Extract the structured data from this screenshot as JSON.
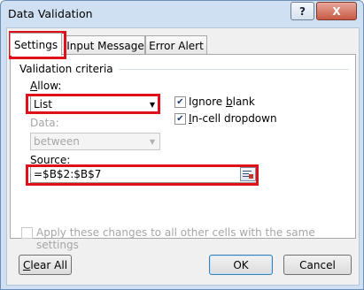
{
  "window": {
    "title": "Data Validation",
    "help_label": "?",
    "close_label": "X"
  },
  "tabs": [
    {
      "label": "Settings",
      "active": true
    },
    {
      "label": "Input Message",
      "active": false
    },
    {
      "label": "Error Alert",
      "active": false
    }
  ],
  "settings": {
    "group_label": "Validation criteria",
    "allow": {
      "label_key": "A",
      "label_rest": "llow:",
      "value": "List"
    },
    "ignore_blank": {
      "label_pre": "Ignore ",
      "label_key": "b",
      "label_rest": "lank",
      "checked": true
    },
    "incell_dropdown": {
      "label_key": "I",
      "label_rest": "n-cell dropdown",
      "checked": true
    },
    "data": {
      "label_pre": "D",
      "label_rest": "ata:",
      "value": "between",
      "enabled": false
    },
    "source": {
      "label_key": "S",
      "label_rest": "ource:",
      "value": "=$B$2:$B$7"
    }
  },
  "apply_all": {
    "label": "Apply these changes to all other cells with the same settings",
    "checked": false,
    "enabled": false
  },
  "buttons": {
    "clear_all": {
      "label_key": "C",
      "label_rest": "lear All"
    },
    "ok": "OK",
    "cancel": "Cancel"
  },
  "colors": {
    "highlight": "#e0101b",
    "chrome": "#cfe0f3"
  }
}
